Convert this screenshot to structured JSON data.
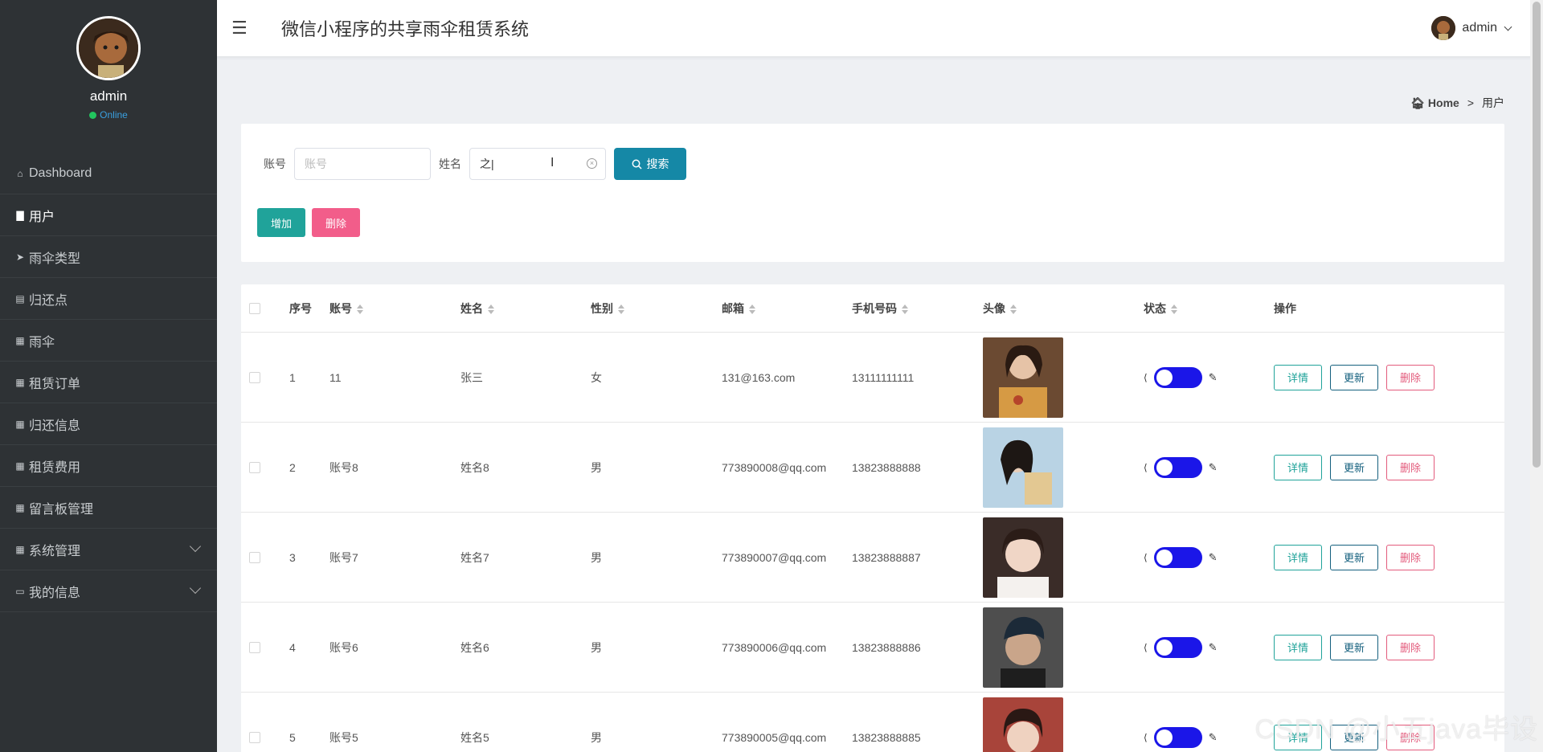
{
  "profile": {
    "name": "admin",
    "status": "Online",
    "status_color": "#22c55e"
  },
  "sidebar": {
    "items": [
      {
        "label": "Dashboard",
        "icon": "home-icon"
      },
      {
        "label": "用户",
        "icon": "bookmark-icon",
        "active": true
      },
      {
        "label": "雨伞类型",
        "icon": "send-icon"
      },
      {
        "label": "归还点",
        "icon": "clipboard-icon"
      },
      {
        "label": "雨伞",
        "icon": "grid-icon"
      },
      {
        "label": "租赁订单",
        "icon": "grid-icon"
      },
      {
        "label": "归还信息",
        "icon": "grid-icon"
      },
      {
        "label": "租赁费用",
        "icon": "grid-icon"
      },
      {
        "label": "留言板管理",
        "icon": "grid-icon"
      },
      {
        "label": "系统管理",
        "icon": "grid-icon",
        "expandable": true
      },
      {
        "label": "我的信息",
        "icon": "card-icon",
        "expandable": true
      }
    ]
  },
  "header": {
    "title": "微信小程序的共享雨伞租赁系统",
    "user": "admin"
  },
  "breadcrumb": {
    "home": "Home",
    "separator": ">",
    "current": "用户"
  },
  "search": {
    "account_label": "账号",
    "account_placeholder": "账号",
    "name_label": "姓名",
    "name_value": "之|",
    "search_button": "搜索",
    "add_button": "增加",
    "delete_button": "删除"
  },
  "table": {
    "headers": {
      "index": "序号",
      "account": "账号",
      "name": "姓名",
      "sex": "性别",
      "email": "邮箱",
      "phone": "手机号码",
      "avatar": "头像",
      "status": "状态",
      "ops": "操作"
    },
    "rows": [
      {
        "index": "1",
        "account": "11",
        "name": "张三",
        "sex": "女",
        "email": "131@163.com",
        "phone": "13111111111"
      },
      {
        "index": "2",
        "account": "账号8",
        "name": "姓名8",
        "sex": "男",
        "email": "773890008@qq.com",
        "phone": "13823888888"
      },
      {
        "index": "3",
        "account": "账号7",
        "name": "姓名7",
        "sex": "男",
        "email": "773890007@qq.com",
        "phone": "13823888887"
      },
      {
        "index": "4",
        "account": "账号6",
        "name": "姓名6",
        "sex": "男",
        "email": "773890006@qq.com",
        "phone": "13823888886"
      },
      {
        "index": "5",
        "account": "账号5",
        "name": "姓名5",
        "sex": "男",
        "email": "773890005@qq.com",
        "phone": "13823888885"
      }
    ],
    "op_detail": "详情",
    "op_update": "更新",
    "op_delete": "删除"
  },
  "colors": {
    "accent": "#1588a6",
    "add": "#20a39a",
    "danger": "#f25d8a",
    "toggle": "#1b16e8",
    "sidebar": "#2e3235"
  },
  "watermark": "CSDN @小五java毕设"
}
